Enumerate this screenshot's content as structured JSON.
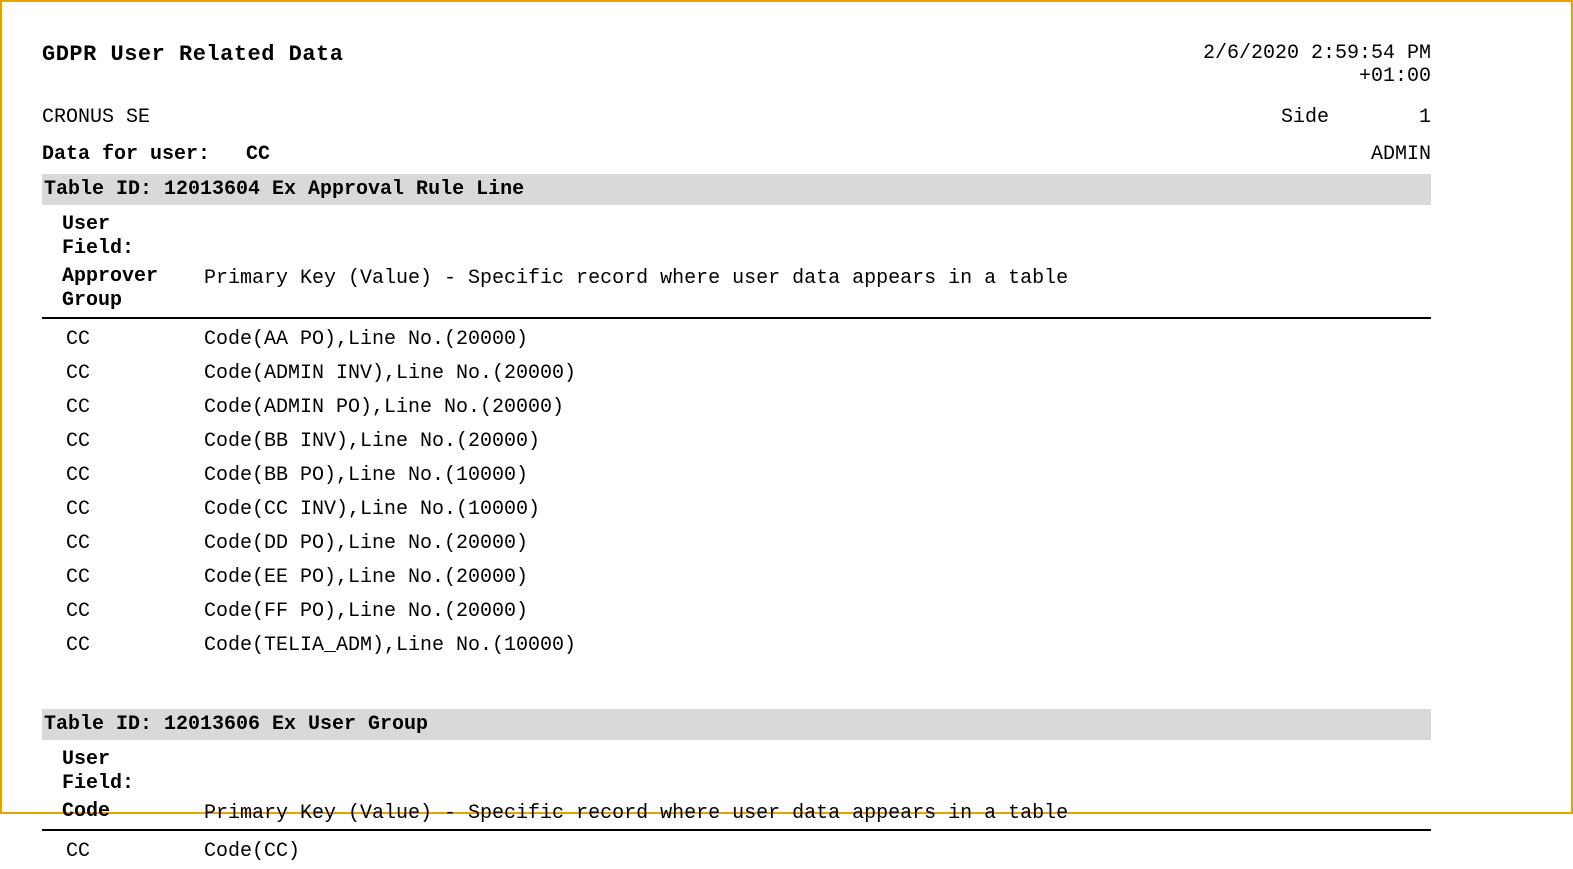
{
  "title": "GDPR User Related Data",
  "timestamp": "2/6/2020 2:59:54 PM",
  "timezone": "+01:00",
  "company": "CRONUS SE",
  "side_label": "Side",
  "side_value": "1",
  "data_for_user_label": "Data for user:",
  "data_for_user_value": "CC",
  "admin_label": "ADMIN",
  "sections": [
    {
      "head": "Table ID: 12013604  Ex Approval Rule Line",
      "user_field_label": "User\nField:",
      "field_name": "Approver Group",
      "pk_note": "Primary Key (Value) - Specific record where user data appears in a table",
      "rows": [
        {
          "c1": "CC",
          "c2": "Code(AA PO),Line No.(20000)"
        },
        {
          "c1": "CC",
          "c2": "Code(ADMIN INV),Line No.(20000)"
        },
        {
          "c1": "CC",
          "c2": "Code(ADMIN PO),Line No.(20000)"
        },
        {
          "c1": "CC",
          "c2": "Code(BB INV),Line No.(20000)"
        },
        {
          "c1": "CC",
          "c2": "Code(BB PO),Line No.(10000)"
        },
        {
          "c1": "CC",
          "c2": "Code(CC INV),Line No.(10000)"
        },
        {
          "c1": "CC",
          "c2": "Code(DD PO),Line No.(20000)"
        },
        {
          "c1": "CC",
          "c2": "Code(EE PO),Line No.(20000)"
        },
        {
          "c1": "CC",
          "c2": "Code(FF PO),Line No.(20000)"
        },
        {
          "c1": "CC",
          "c2": "Code(TELIA_ADM),Line No.(10000)"
        }
      ]
    },
    {
      "head": "Table ID: 12013606  Ex User Group",
      "user_field_label": "User\nField:",
      "field_name": "Code",
      "pk_note": "Primary Key (Value) - Specific record where user data appears in a table",
      "rows": [
        {
          "c1": "CC",
          "c2": "Code(CC)"
        }
      ]
    }
  ]
}
